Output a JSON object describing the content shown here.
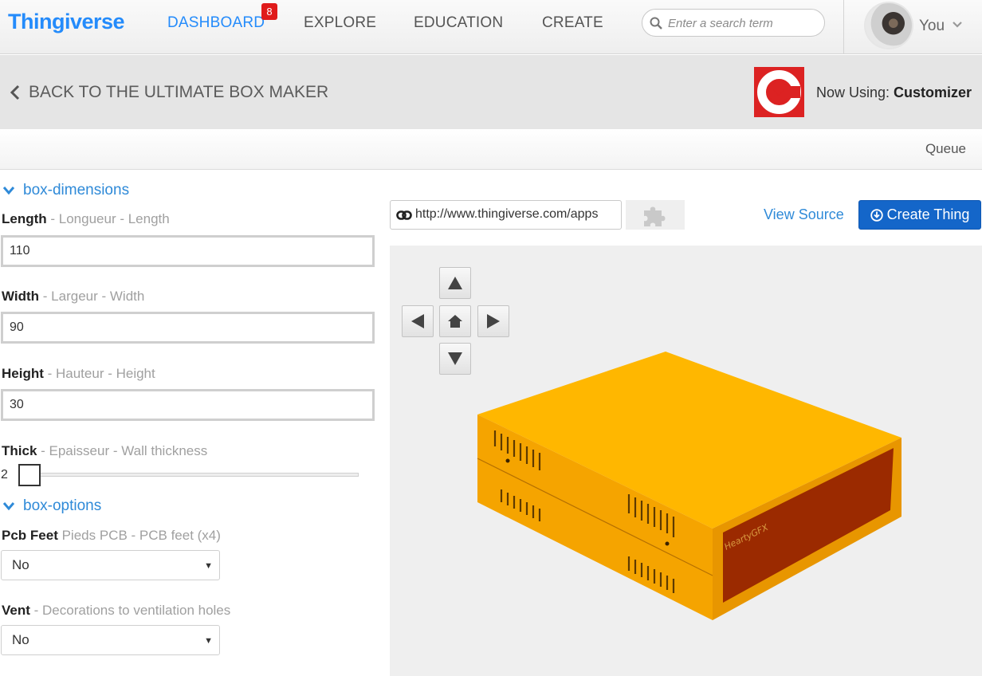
{
  "nav": {
    "logo": "Thingiverse",
    "items": [
      "DASHBOARD",
      "EXPLORE",
      "EDUCATION",
      "CREATE"
    ],
    "dashboard_badge": "8",
    "search_placeholder": "Enter a search term",
    "user_label": "You"
  },
  "header": {
    "back_label": "BACK TO THE ULTIMATE BOX MAKER",
    "now_using_prefix": "Now Using:",
    "now_using_app": "Customizer"
  },
  "queue_label": "Queue",
  "form": {
    "sections": [
      "box-dimensions",
      "box-options"
    ],
    "length": {
      "name": "Length",
      "desc": " - Longueur - Length",
      "value": "110"
    },
    "width": {
      "name": "Width",
      "desc": " - Largeur - Width",
      "value": "90"
    },
    "height": {
      "name": "Height",
      "desc": " - Hauteur - Height",
      "value": "30"
    },
    "thick": {
      "name": "Thick",
      "desc": " - Epaisseur - Wall thickness",
      "value": "2",
      "level": 0
    },
    "pcb_feet": {
      "name": "Pcb Feet",
      "desc": " Pieds PCB - PCB feet (x4)",
      "value": "No"
    },
    "vent": {
      "name": "Vent",
      "desc": " - Decorations to ventilation holes",
      "value": "No"
    }
  },
  "toolbar": {
    "url": "http://www.thingiverse.com/apps",
    "view_source": "View Source",
    "create_thing": "Create Thing"
  },
  "preview": {
    "model_label": "HeartyGFX",
    "model_color": "#fdb400",
    "panel_color": "#9b2a00"
  },
  "colors": {
    "brand_blue": "#248bfb",
    "link_blue": "#2f8ad8",
    "button_blue": "#1466c9",
    "badge_red": "#e01b1b",
    "app_logo_red": "#dc2222"
  }
}
